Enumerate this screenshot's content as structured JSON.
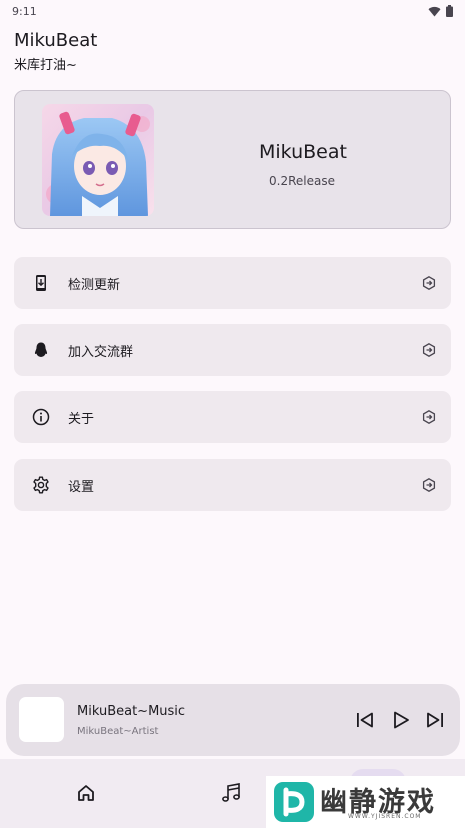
{
  "status_bar": {
    "time": "9:11"
  },
  "header": {
    "title": "MikuBeat",
    "subtitle": "米库打油~"
  },
  "hero": {
    "name": "MikuBeat",
    "version": "0.2Release"
  },
  "menu": [
    {
      "label": "检测更新",
      "icon": "phone-download-icon"
    },
    {
      "label": "加入交流群",
      "icon": "qq-icon"
    },
    {
      "label": "关于",
      "icon": "info-icon"
    },
    {
      "label": "设置",
      "icon": "gear-icon"
    }
  ],
  "player": {
    "title": "MikuBeat~Music",
    "artist": "MikuBeat~Artist"
  },
  "watermark": {
    "text": "幽静游戏",
    "url": "WWW.YJISREN.COM"
  },
  "colors": {
    "accent": "#1fb6a8",
    "background": "#fdf8fc",
    "card": "#efe9ee"
  }
}
